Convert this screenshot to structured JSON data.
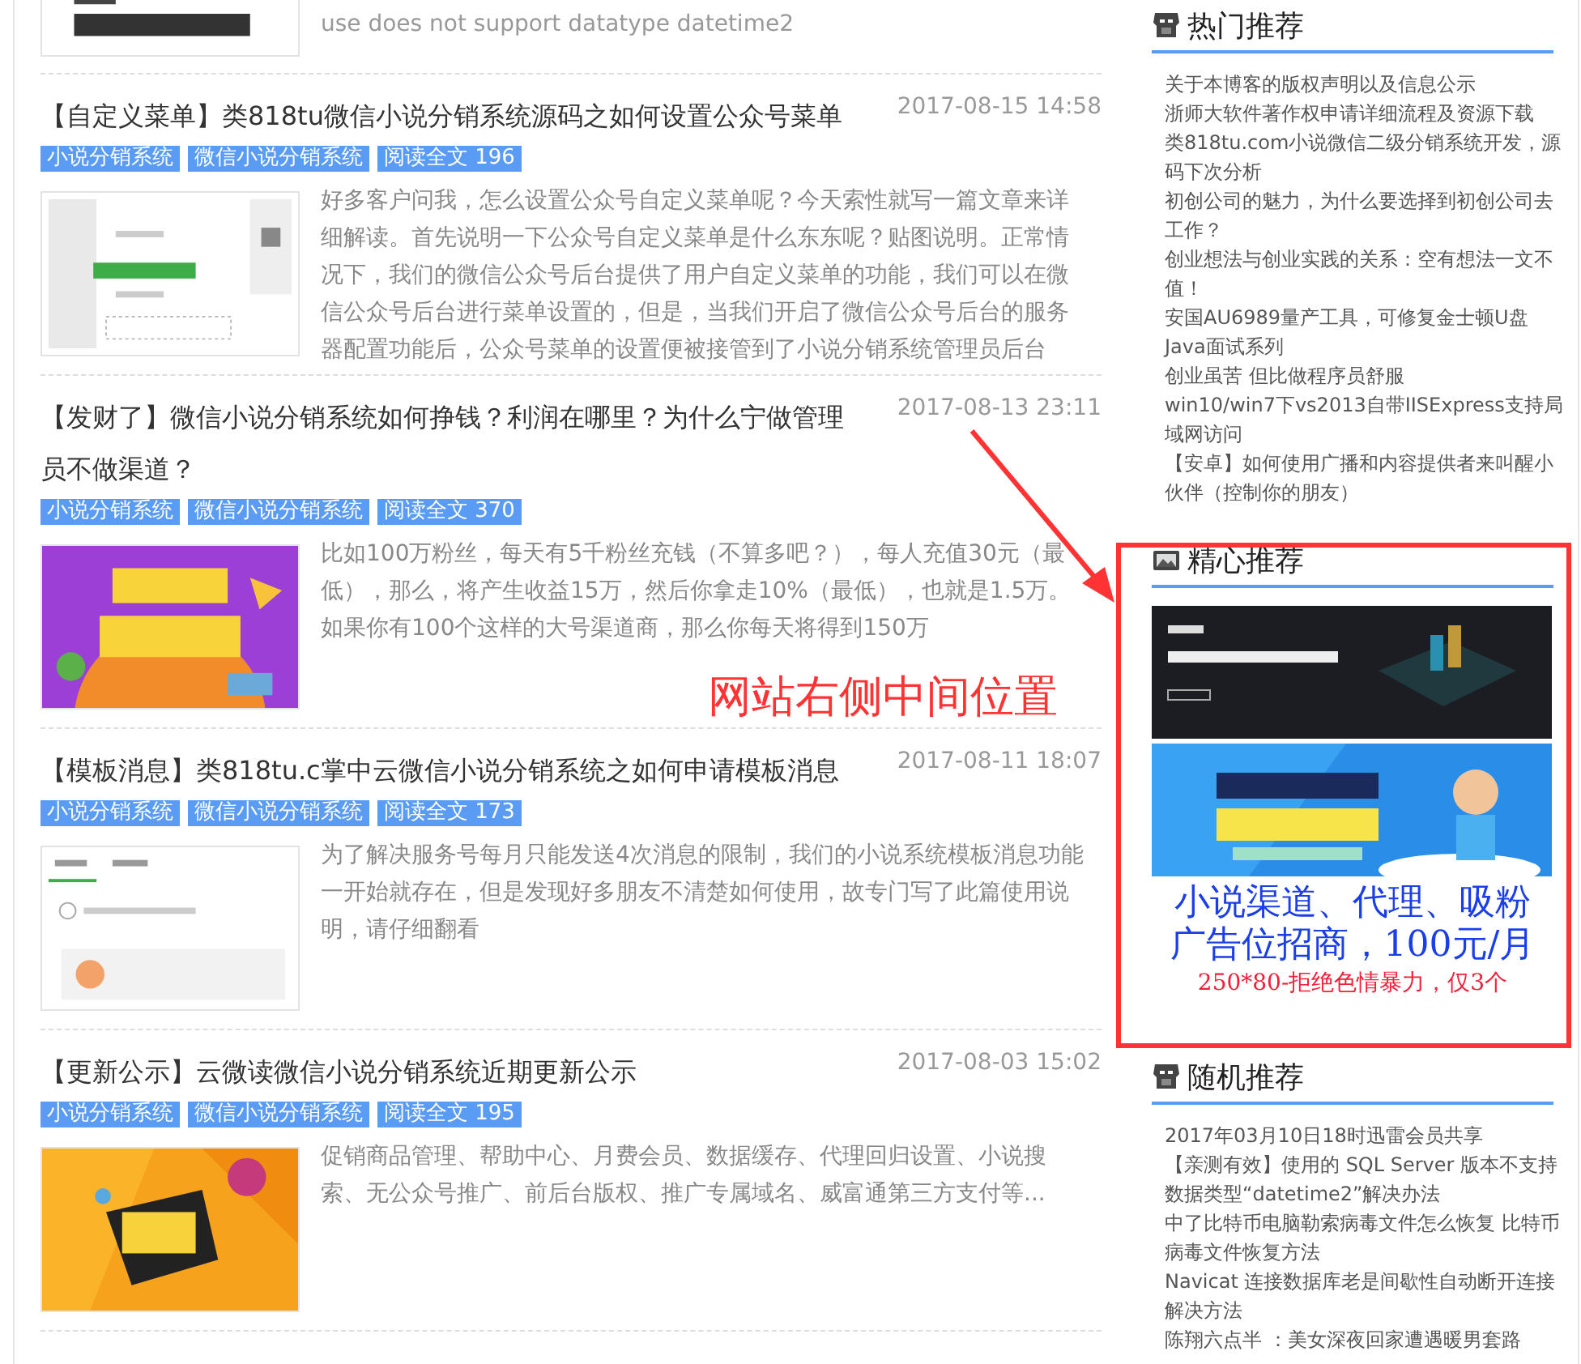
{
  "top_post": {
    "excerpt": "use does not support datatype    datetime2"
  },
  "posts": [
    {
      "title": "【自定义菜单】类818tu微信小说分销系统源码之如何设置公众号菜单",
      "date": "2017-08-15 14:58",
      "tags": [
        "小说分销系统",
        "微信小说分销系统",
        "阅读全文 196"
      ],
      "excerpt": "好多客户问我，怎么设置公众号自定义菜单呢？今天索性就写一篇文章来详细解读。首先说明一下公众号自定义菜单是什么东东呢？贴图说明。正常情况下，我们的微信公众号后台提供了用户自定义菜单的功能，我们可以在微信公众号后台进行菜单设置的，但是，当我们开启了微信公众号后台的服务器配置功能后，公众号菜单的设置便被接管到了小说分销系统管理员后台"
    },
    {
      "title": "【发财了】微信小说分销系统如何挣钱？利润在哪里？为什么宁做管理员不做渠道？",
      "date": "2017-08-13 23:11",
      "tags": [
        "小说分销系统",
        "微信小说分销系统",
        "阅读全文 370"
      ],
      "excerpt": "比如100万粉丝，每天有5千粉丝充钱（不算多吧？），每人充值30元（最低），那么，将产生收益15万，然后你拿走10%（最低），也就是1.5万。如果你有100个这样的大号渠道商，那么你每天将得到150万"
    },
    {
      "title": "【模板消息】类818tu.c掌中云微信小说分销系统之如何申请模板消息",
      "date": "2017-08-11 18:07",
      "tags": [
        "小说分销系统",
        "微信小说分销系统",
        "阅读全文 173"
      ],
      "excerpt": "为了解决服务号每月只能发送4次消息的限制，我们的小说系统模板消息功能一开始就存在，但是发现好多朋友不清楚如何使用，故专门写了此篇使用说明，请仔细翻看"
    },
    {
      "title": "【更新公示】云微读微信小说分销系统近期更新公示",
      "date": "2017-08-03 15:02",
      "tags": [
        "小说分销系统",
        "微信小说分销系统",
        "阅读全文 195"
      ],
      "excerpt": "促销商品管理、帮助中心、月费会员、数据缓存、代理回归设置、小说搜索、无公众号推广、前后台版权、推广专属域名、威富通第三方支付等..."
    }
  ],
  "sidebar": [
    {
      "kind": "list",
      "title": "热门推荐",
      "items": [
        "关于本博客的版权声明以及信息公示",
        "浙师大软件著作权申请详细流程及资源下载",
        "类818tu.com小说微信二级分销系统开发，源码下次分析",
        "初创公司的魅力，为什么要选择到初创公司去工作？",
        "创业想法与创业实践的关系：空有想法一文不值！",
        "安国AU6989量产工具，可修复金士顿U盘",
        "Java面试系列",
        "创业虽苦 但比做程序员舒服",
        "win10/win7下vs2013自带IISExpress支持局域网访问",
        "【安卓】如何使用广播和内容提供者来叫醒小伙伴（控制你的朋友）"
      ]
    },
    {
      "kind": "ads",
      "title": "精心推荐",
      "ad_lines": [
        "小说渠道、代理、吸粉",
        "广告位招商，100元/月"
      ],
      "ad_note": "250*80-拒绝色情暴力，仅3个"
    },
    {
      "kind": "list",
      "title": "随机推荐",
      "items": [
        "2017年03月10日18时迅雷会员共享",
        "【亲测有效】使用的 SQL Server 版本不支持数据类型“datetime2”解决办法",
        "中了比特币电脑勒索病毒文件怎么恢复 比特币病毒文件恢复方法",
        "Navicat 连接数据库老是间歇性自动断开连接解决方法",
        "陈翔六点半 ：美女深夜回家遭遇暖男套路"
      ]
    }
  ],
  "annotation": {
    "text": "网站右侧中间位置"
  }
}
